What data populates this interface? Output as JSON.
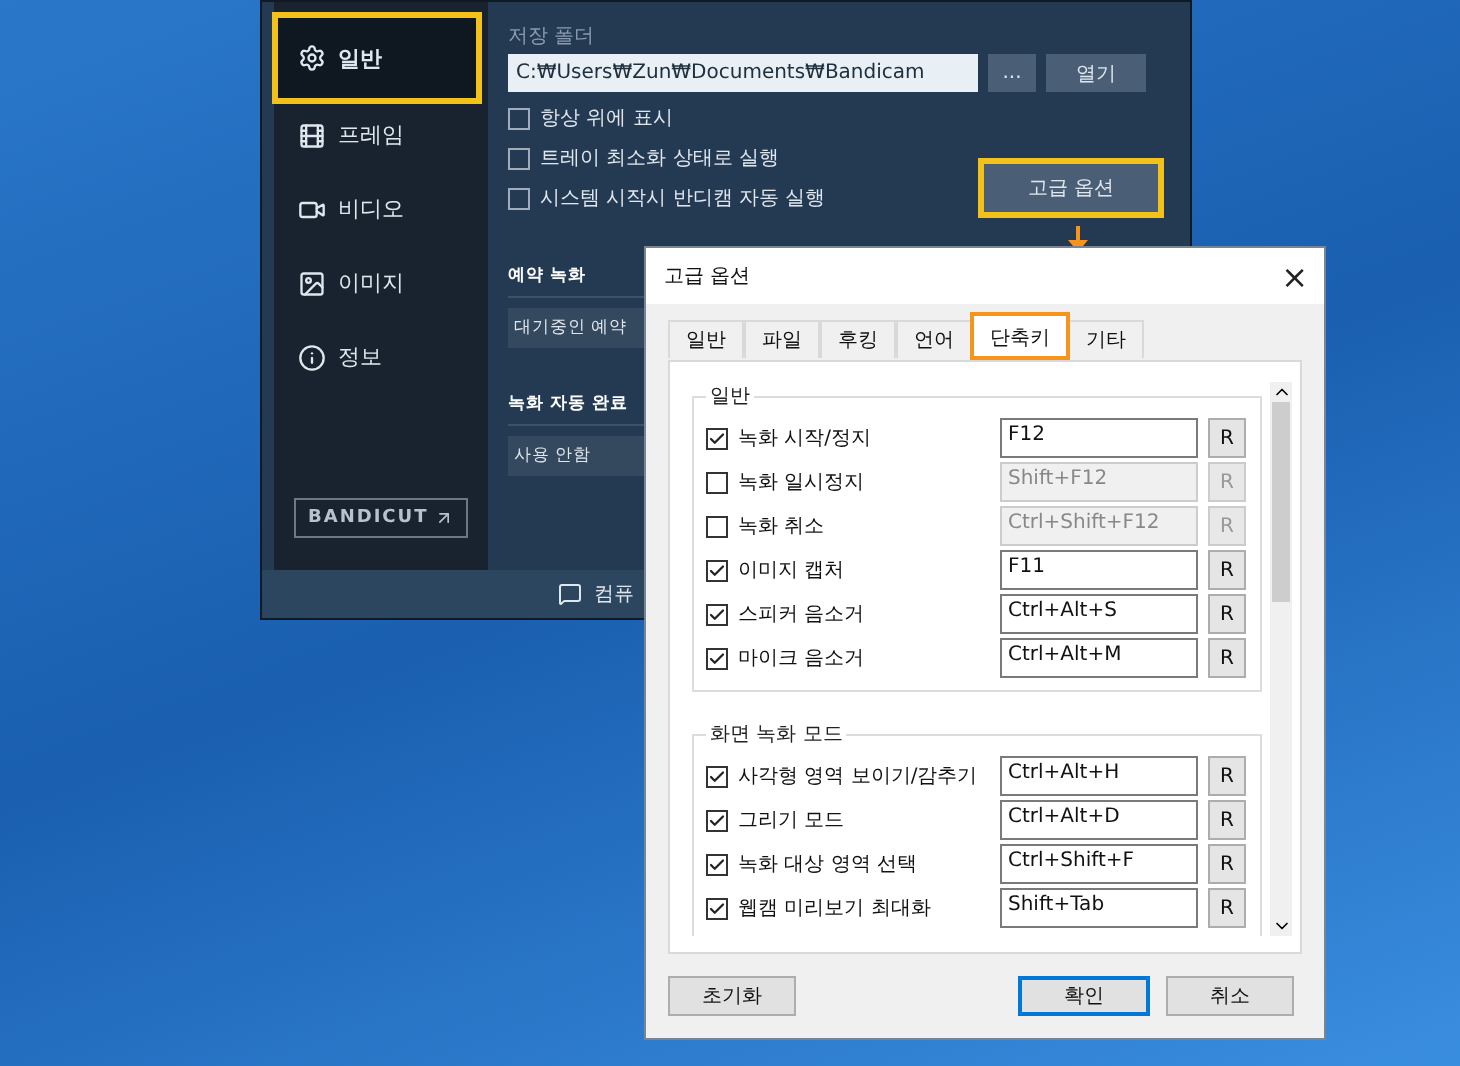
{
  "main_window": {
    "sidebar": [
      {
        "label": "일반",
        "selected": true,
        "highlighted": true
      },
      {
        "label": "프레임",
        "selected": false,
        "highlighted": false
      },
      {
        "label": "비디오",
        "selected": false,
        "highlighted": false
      },
      {
        "label": "이미지",
        "selected": false,
        "highlighted": false
      },
      {
        "label": "정보",
        "selected": false,
        "highlighted": false
      }
    ],
    "bandicut": "BANDICUT",
    "save_folder": {
      "label": "저장 폴더",
      "path": "C:₩Users₩Zun₩Documents₩Bandicam",
      "browse": "...",
      "open": "열기"
    },
    "options": [
      {
        "label": "항상 위에 표시",
        "checked": false
      },
      {
        "label": "트레이 최소화 상태로 실행",
        "checked": false
      },
      {
        "label": "시스템 시작시 반디캠 자동 실행",
        "checked": false
      }
    ],
    "advanced_button": {
      "label": "고급 옵션",
      "highlighted": true
    },
    "scheduled": {
      "label": "예약 녹화",
      "value": "대기중인 예약"
    },
    "auto_complete": {
      "label": "녹화 자동 완료",
      "value": "사용 안함"
    },
    "footer": "컴퓨"
  },
  "dialog": {
    "title": "고급 옵션",
    "close": "×",
    "tabs": [
      {
        "label": "일반",
        "selected": false,
        "highlighted": false
      },
      {
        "label": "파일",
        "selected": false,
        "highlighted": false
      },
      {
        "label": "후킹",
        "selected": false,
        "highlighted": false
      },
      {
        "label": "언어",
        "selected": false,
        "highlighted": false
      },
      {
        "label": "단축키",
        "selected": true,
        "highlighted": true
      },
      {
        "label": "기타",
        "selected": false,
        "highlighted": false
      }
    ],
    "groups": [
      {
        "title": "일반",
        "rows": [
          {
            "label": "녹화 시작/정지",
            "checked": true,
            "key": "F12",
            "reset": "R"
          },
          {
            "label": "녹화 일시정지",
            "checked": false,
            "key": "Shift+F12",
            "reset": "R"
          },
          {
            "label": "녹화 취소",
            "checked": false,
            "key": "Ctrl+Shift+F12",
            "reset": "R"
          },
          {
            "label": "이미지 캡처",
            "checked": true,
            "key": "F11",
            "reset": "R"
          },
          {
            "label": "스피커 음소거",
            "checked": true,
            "key": "Ctrl+Alt+S",
            "reset": "R"
          },
          {
            "label": "마이크 음소거",
            "checked": true,
            "key": "Ctrl+Alt+M",
            "reset": "R"
          }
        ]
      },
      {
        "title": "화면 녹화 모드",
        "rows": [
          {
            "label": "사각형 영역 보이기/감추기",
            "checked": true,
            "key": "Ctrl+Alt+H",
            "reset": "R"
          },
          {
            "label": "그리기 모드",
            "checked": true,
            "key": "Ctrl+Alt+D",
            "reset": "R"
          },
          {
            "label": "녹화 대상 영역 선택",
            "checked": true,
            "key": "Ctrl+Shift+F",
            "reset": "R"
          },
          {
            "label": "웹캠 미리보기 최대화",
            "checked": true,
            "key": "Shift+Tab",
            "reset": "R"
          }
        ]
      }
    ],
    "buttons": [
      {
        "label": "초기화",
        "default": false
      },
      {
        "label": "확인",
        "default": true
      },
      {
        "label": "취소",
        "default": false
      }
    ]
  }
}
